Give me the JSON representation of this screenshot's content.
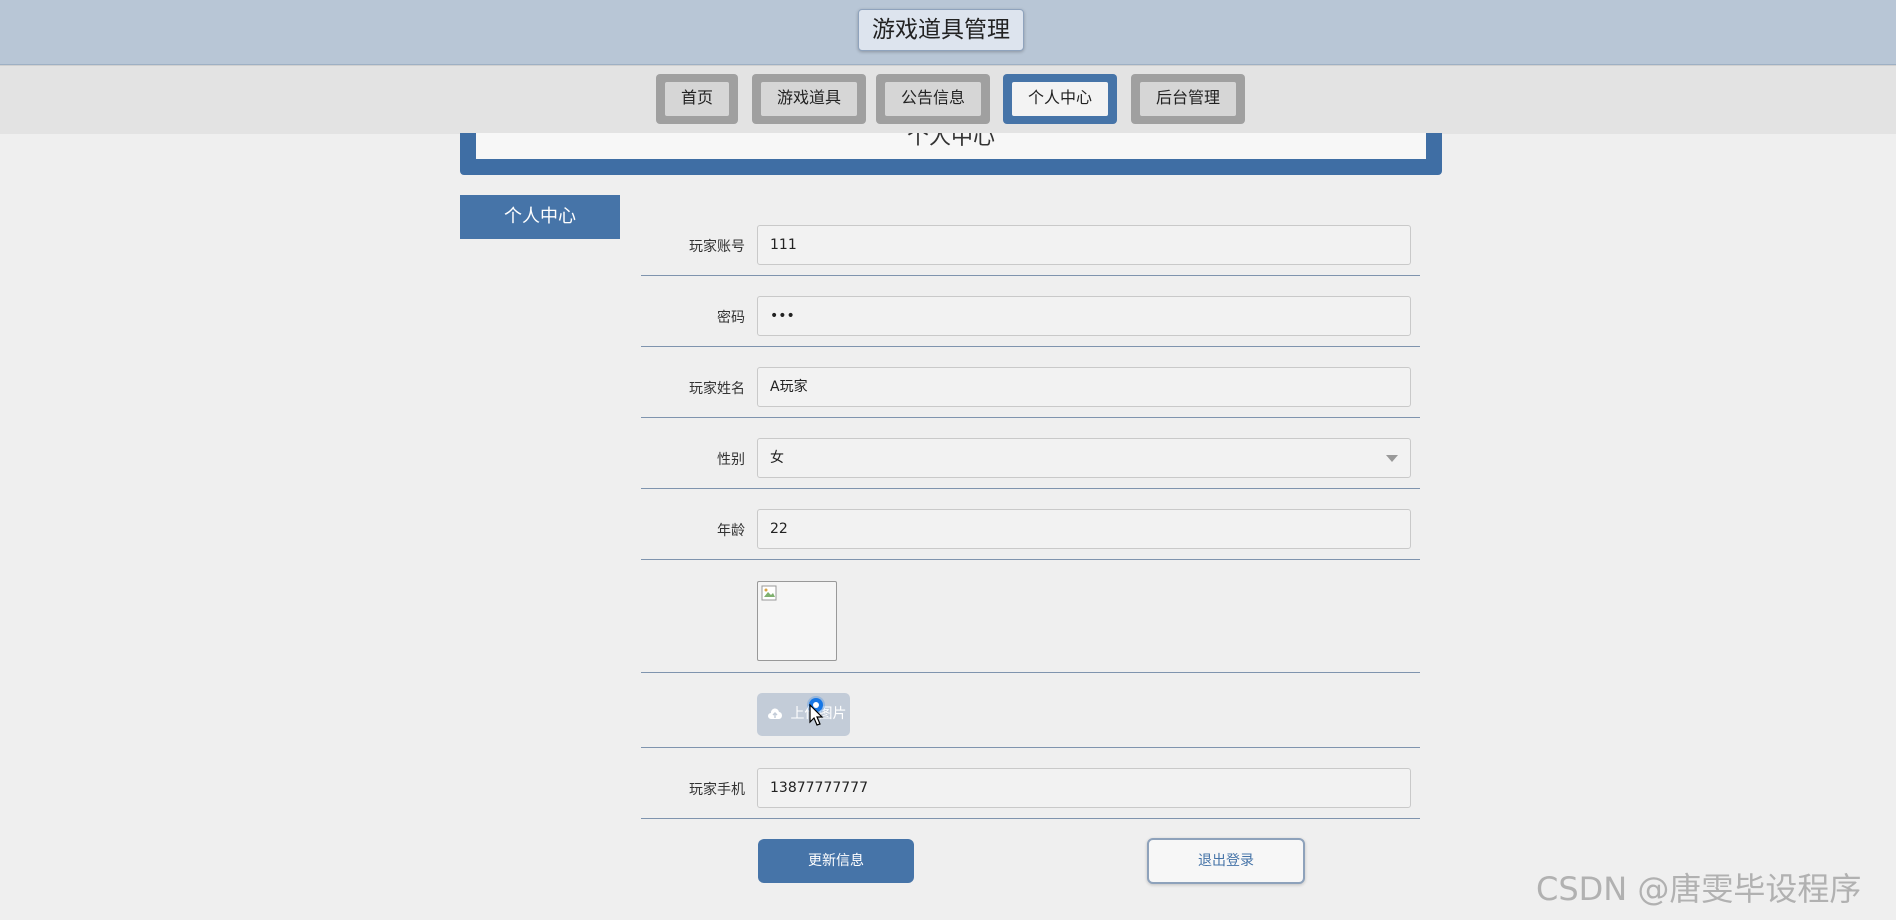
{
  "site": {
    "title": "游戏道具管理"
  },
  "nav": {
    "items": [
      {
        "label": "首页"
      },
      {
        "label": "游戏道具"
      },
      {
        "label": "公告信息"
      },
      {
        "label": "个人中心"
      },
      {
        "label": "后台管理"
      }
    ],
    "active_index": 3
  },
  "page": {
    "header_title": "个人中心",
    "sidebar_tab": "个人中心"
  },
  "form": {
    "account": {
      "label": "玩家账号",
      "value": "111"
    },
    "password": {
      "label": "密码",
      "value": "•••"
    },
    "name": {
      "label": "玩家姓名",
      "value": "A玩家"
    },
    "gender": {
      "label": "性别",
      "value": "女"
    },
    "age": {
      "label": "年龄",
      "value": "22"
    },
    "avatar": {
      "alt": ""
    },
    "upload": {
      "label": "上传图片"
    },
    "phone": {
      "label": "玩家手机",
      "value": "13877777777"
    }
  },
  "actions": {
    "update_label": "更新信息",
    "logout_label": "退出登录"
  },
  "watermark": "CSDN @唐雯毕设程序",
  "colors": {
    "primary": "#4674a8",
    "topbar": "#b8c6d6",
    "background": "#efefef"
  }
}
